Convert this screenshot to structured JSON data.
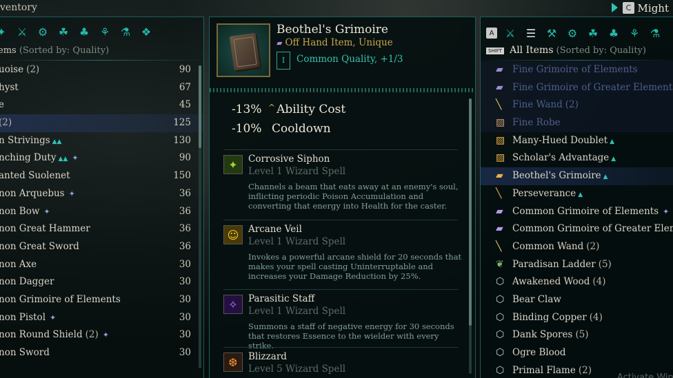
{
  "topbar": {
    "title": "ventory",
    "key": "C",
    "might": "Might"
  },
  "left": {
    "categories": [
      "✦",
      "⚔",
      "⚙",
      "☘",
      "♣",
      "⚘",
      "⚗",
      "❖"
    ],
    "header": {
      "label": "ems",
      "sub": "(Sorted by: Quality)"
    },
    "rows": [
      {
        "name": "uoise",
        "count": "(2)",
        "value": "90",
        "up": false,
        "glyph": ""
      },
      {
        "name": "hyst",
        "count": "",
        "value": "67",
        "up": false,
        "glyph": ""
      },
      {
        "name": "e",
        "count": "",
        "value": "45",
        "up": false,
        "glyph": ""
      },
      {
        "name": "",
        "count": "(2)",
        "value": "125",
        "up": false,
        "glyph": "",
        "selected": true
      },
      {
        "name": "n Strivings",
        "count": "",
        "value": "130",
        "up": true,
        "glyph": ""
      },
      {
        "name": "nching Duty",
        "count": "",
        "value": "90",
        "up": true,
        "glyph": "✦"
      },
      {
        "name": "anted Suolenet",
        "count": "",
        "value": "150",
        "up": false,
        "glyph": ""
      },
      {
        "name": "non Arquebus",
        "count": "",
        "value": "36",
        "up": false,
        "glyph": "✦"
      },
      {
        "name": "non Bow",
        "count": "",
        "value": "36",
        "up": false,
        "glyph": "✦"
      },
      {
        "name": "non Great Hammer",
        "count": "",
        "value": "36",
        "up": false,
        "glyph": ""
      },
      {
        "name": "non Great Sword",
        "count": "",
        "value": "36",
        "up": false,
        "glyph": ""
      },
      {
        "name": "non Axe",
        "count": "",
        "value": "30",
        "up": false,
        "glyph": ""
      },
      {
        "name": "non Dagger",
        "count": "",
        "value": "30",
        "up": false,
        "glyph": ""
      },
      {
        "name": "non Grimoire of Elements",
        "count": "",
        "value": "30",
        "up": false,
        "glyph": ""
      },
      {
        "name": "non Pistol",
        "count": "",
        "value": "30",
        "up": false,
        "glyph": "✦"
      },
      {
        "name": "non Round Shield",
        "count": "(2)",
        "value": "30",
        "up": false,
        "glyph": "✦"
      },
      {
        "name": "non Sword",
        "count": "",
        "value": "30",
        "up": false,
        "glyph": ""
      }
    ]
  },
  "item": {
    "name": "Beothel's Grimoire",
    "type": "Off Hand Item, Unique",
    "tier": "I",
    "quality": "Common Quality, +1/3",
    "stats": [
      {
        "value": "-13%",
        "caret": "^",
        "label": "Ability Cost"
      },
      {
        "value": "-10%",
        "caret": "",
        "label": "Cooldown"
      }
    ],
    "skills": [
      {
        "name": "Corrosive Siphon",
        "level": "Level 1 Wizard Spell",
        "desc": "Channels a beam that eats away at an enemy's soul, inflicting periodic Poison Accumulation and converting that energy into Health for the caster.",
        "icon": "✦",
        "color": "#b4c83a",
        "bg": "#223a10"
      },
      {
        "name": "Arcane Veil",
        "level": "Level 1 Wizard Spell",
        "desc": "Invokes a powerful arcane shield for 20 seconds that makes your spell casting Uninterruptable and increases your Damage Reduction by 25%.",
        "icon": "☺",
        "color": "#f1cc3c",
        "bg": "#4a3a06"
      },
      {
        "name": "Parasitic Staff",
        "level": "Level 1 Wizard Spell",
        "desc": "Summons a staff of negative energy for 30 seconds that restores Essence to the wielder with every strike.",
        "icon": "✧",
        "color": "#b37cff",
        "bg": "#241040"
      },
      {
        "name": "Blizzard",
        "level": "Level 5 Wizard Spell",
        "desc": "",
        "icon": "❆",
        "color": "#e08a3a",
        "bg": "#2a1a10"
      }
    ]
  },
  "right": {
    "keyA": "A",
    "shift": "SHIFT",
    "categories": [
      "⚔",
      "☰",
      "⚒",
      "⚙",
      "☘",
      "♣",
      "⚘",
      "⚗"
    ],
    "header": {
      "label": "All Items",
      "sub": "(Sorted by: Quality)"
    },
    "rows": [
      {
        "name": "Fine Grimoire of Elements",
        "count": "",
        "icon": "▰",
        "ic": "#9c8cd8",
        "dim": true,
        "up": false,
        "glyph": ""
      },
      {
        "name": "Fine Grimoire of Greater Elements",
        "count": "",
        "icon": "▰",
        "ic": "#9c8cd8",
        "dim": true,
        "up": false,
        "glyph": ""
      },
      {
        "name": "Fine Wand",
        "count": "(2)",
        "icon": "╲",
        "ic": "#e8c46a",
        "dim": true,
        "up": false,
        "glyph": ""
      },
      {
        "name": "Fine Robe",
        "count": "",
        "icon": "▨",
        "ic": "#c89a6a",
        "dim": true,
        "up": false,
        "glyph": ""
      },
      {
        "name": "Many-Hued Doublet",
        "count": "",
        "icon": "▨",
        "ic": "#e8b04a",
        "dim": false,
        "up": true,
        "glyph": ""
      },
      {
        "name": "Scholar's Advantage",
        "count": "",
        "icon": "▨",
        "ic": "#e8b04a",
        "dim": false,
        "up": true,
        "glyph": ""
      },
      {
        "name": "Beothel's Grimoire",
        "count": "",
        "icon": "▰",
        "ic": "#e8b04a",
        "dim": false,
        "up": true,
        "glyph": "",
        "selected": true
      },
      {
        "name": "Perseverance",
        "count": "",
        "icon": "╲",
        "ic": "#e8b04a",
        "dim": false,
        "up": true,
        "glyph": ""
      },
      {
        "name": "Common Grimoire of Elements",
        "count": "",
        "icon": "▰",
        "ic": "#b39ae8",
        "dim": false,
        "up": false,
        "glyph": "✦"
      },
      {
        "name": "Common Grimoire of Greater Elemen",
        "count": "",
        "icon": "▰",
        "ic": "#b39ae8",
        "dim": false,
        "up": false,
        "glyph": ""
      },
      {
        "name": "Common Wand",
        "count": "(2)",
        "icon": "╲",
        "ic": "#e8c46a",
        "dim": false,
        "up": false,
        "glyph": ""
      },
      {
        "name": "Paradisan Ladder",
        "count": "(5)",
        "icon": "❦",
        "ic": "#7ab86a",
        "dim": false,
        "up": false,
        "glyph": ""
      },
      {
        "name": "Awakened Wood",
        "count": "(4)",
        "icon": "⬡",
        "ic": "#cfd6d2",
        "dim": false,
        "up": false,
        "glyph": ""
      },
      {
        "name": "Bear Claw",
        "count": "",
        "icon": "⬡",
        "ic": "#cfd6d2",
        "dim": false,
        "up": false,
        "glyph": ""
      },
      {
        "name": "Binding Copper",
        "count": "(4)",
        "icon": "⬡",
        "ic": "#cfd6d2",
        "dim": false,
        "up": false,
        "glyph": ""
      },
      {
        "name": "Dank Spores",
        "count": "(5)",
        "icon": "⬡",
        "ic": "#cfd6d2",
        "dim": false,
        "up": false,
        "glyph": ""
      },
      {
        "name": "Ogre Blood",
        "count": "",
        "icon": "⬡",
        "ic": "#cfd6d2",
        "dim": false,
        "up": false,
        "glyph": ""
      },
      {
        "name": "Primal Flame",
        "count": "(2)",
        "icon": "⬡",
        "ic": "#cfd6d2",
        "dim": false,
        "up": false,
        "glyph": ""
      }
    ]
  },
  "watermark": "Activate Wind"
}
